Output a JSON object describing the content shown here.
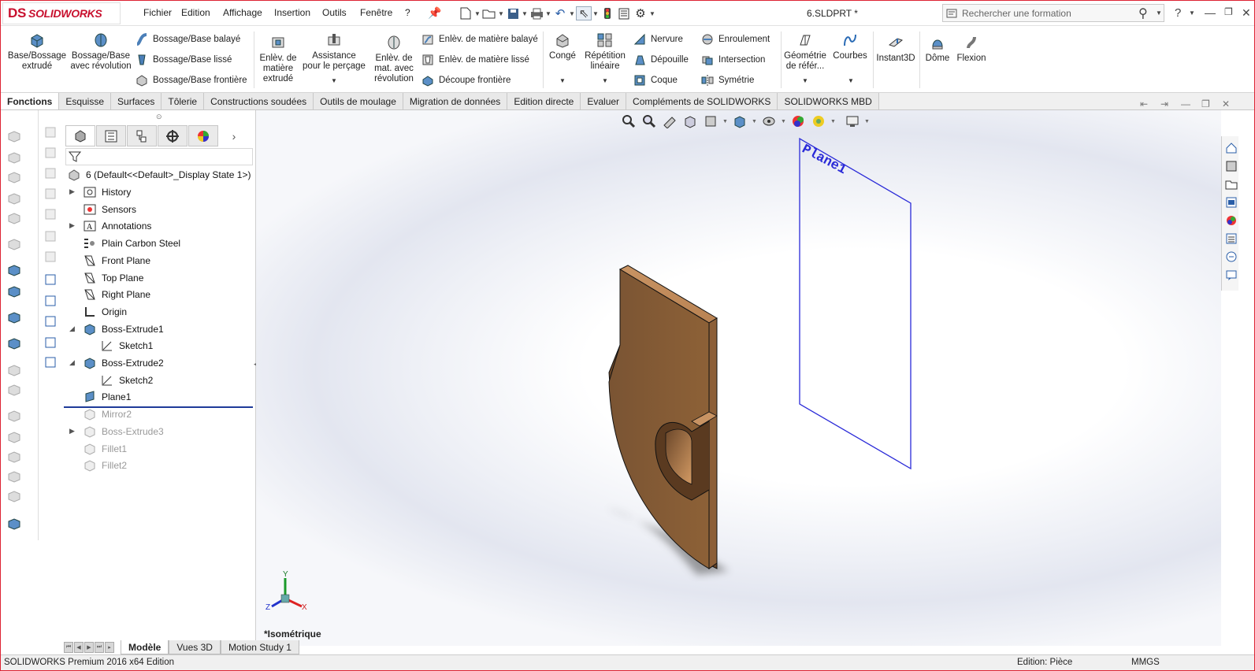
{
  "app": {
    "logo_text": "SOLIDWORKS",
    "logo_mark": "DS",
    "file_title": "6.SLDPRT *"
  },
  "menu": [
    "Fichier",
    "Edition",
    "Affichage",
    "Insertion",
    "Outils",
    "Fenêtre",
    "?"
  ],
  "search": {
    "placeholder": "Rechercher une formation"
  },
  "help": "?",
  "ribbon": {
    "extrude": "Base/Bossage extrudé",
    "revolve": "Bossage/Base avec révolution",
    "swept": "Bossage/Base balayé",
    "loft": "Bossage/Base lissé",
    "boundary": "Bossage/Base frontière",
    "cut_extrude": "Enlèv. de matière extrudé",
    "hole_wizard": "Assistance pour le perçage",
    "cut_revolve": "Enlèv. de mat. avec révolution",
    "cut_swept": "Enlèv. de matière balayé",
    "cut_loft": "Enlèv. de matière lissé",
    "cut_boundary": "Découpe frontière",
    "fillet": "Congé",
    "linear_pattern": "Répétition linéaire",
    "rib": "Nervure",
    "draft": "Dépouille",
    "shell": "Coque",
    "wrap": "Enroulement",
    "intersect": "Intersection",
    "mirror": "Symétrie",
    "ref_geometry": "Géométrie de référ...",
    "curves": "Courbes",
    "instant3d": "Instant3D",
    "dome": "Dôme",
    "flex": "Flexion"
  },
  "tabs": [
    "Fonctions",
    "Esquisse",
    "Surfaces",
    "Tôlerie",
    "Constructions soudées",
    "Outils de moulage",
    "Migration de données",
    "Edition directe",
    "Evaluer",
    "Compléments de SOLIDWORKS",
    "SOLIDWORKS MBD"
  ],
  "tree": {
    "root": "6  (Default<<Default>_Display State 1>)",
    "items": [
      {
        "label": "History",
        "icon": "history-icon",
        "expandable": true,
        "indent": 0,
        "suppressed": false
      },
      {
        "label": "Sensors",
        "icon": "sensor-icon",
        "expandable": false,
        "indent": 0,
        "suppressed": false
      },
      {
        "label": "Annotations",
        "icon": "annotation-icon",
        "expandable": true,
        "indent": 0,
        "suppressed": false
      },
      {
        "label": "Plain Carbon Steel",
        "icon": "material-icon",
        "expandable": false,
        "indent": 0,
        "suppressed": false
      },
      {
        "label": "Front Plane",
        "icon": "plane-icon",
        "expandable": false,
        "indent": 0,
        "suppressed": false
      },
      {
        "label": "Top Plane",
        "icon": "plane-icon",
        "expandable": false,
        "indent": 0,
        "suppressed": false
      },
      {
        "label": "Right Plane",
        "icon": "plane-icon",
        "expandable": false,
        "indent": 0,
        "suppressed": false
      },
      {
        "label": "Origin",
        "icon": "origin-icon",
        "expandable": false,
        "indent": 0,
        "suppressed": false
      },
      {
        "label": "Boss-Extrude1",
        "icon": "extrude-icon",
        "expandable": true,
        "expanded": true,
        "indent": 0,
        "suppressed": false
      },
      {
        "label": "Sketch1",
        "icon": "sketch-icon",
        "expandable": false,
        "indent": 1,
        "suppressed": false
      },
      {
        "label": "Boss-Extrude2",
        "icon": "extrude-icon",
        "expandable": true,
        "expanded": true,
        "indent": 0,
        "suppressed": false
      },
      {
        "label": "Sketch2",
        "icon": "sketch-icon",
        "expandable": false,
        "indent": 1,
        "suppressed": false
      },
      {
        "label": "Plane1",
        "icon": "plane-feature-icon",
        "expandable": false,
        "indent": 0,
        "suppressed": false
      },
      {
        "label": "Mirror2",
        "icon": "mirror-icon",
        "expandable": false,
        "indent": 0,
        "suppressed": true
      },
      {
        "label": "Boss-Extrude3",
        "icon": "extrude-icon",
        "expandable": true,
        "indent": 0,
        "suppressed": true
      },
      {
        "label": "Fillet1",
        "icon": "fillet-icon",
        "expandable": false,
        "indent": 0,
        "suppressed": true
      },
      {
        "label": "Fillet2",
        "icon": "fillet-icon",
        "expandable": false,
        "indent": 0,
        "suppressed": true
      }
    ]
  },
  "viewport": {
    "plane_label": "Plane1",
    "view_name": "*Isométrique",
    "triad": {
      "x": "X",
      "y": "Y",
      "z": "Z"
    },
    "part_color": "#8c6239"
  },
  "bottom_tabs": [
    "Modèle",
    "Vues 3D",
    "Motion Study 1"
  ],
  "status": {
    "left": "SOLIDWORKS Premium 2016 x64 Edition",
    "mid": "Edition: Pièce",
    "units": "MMGS"
  }
}
